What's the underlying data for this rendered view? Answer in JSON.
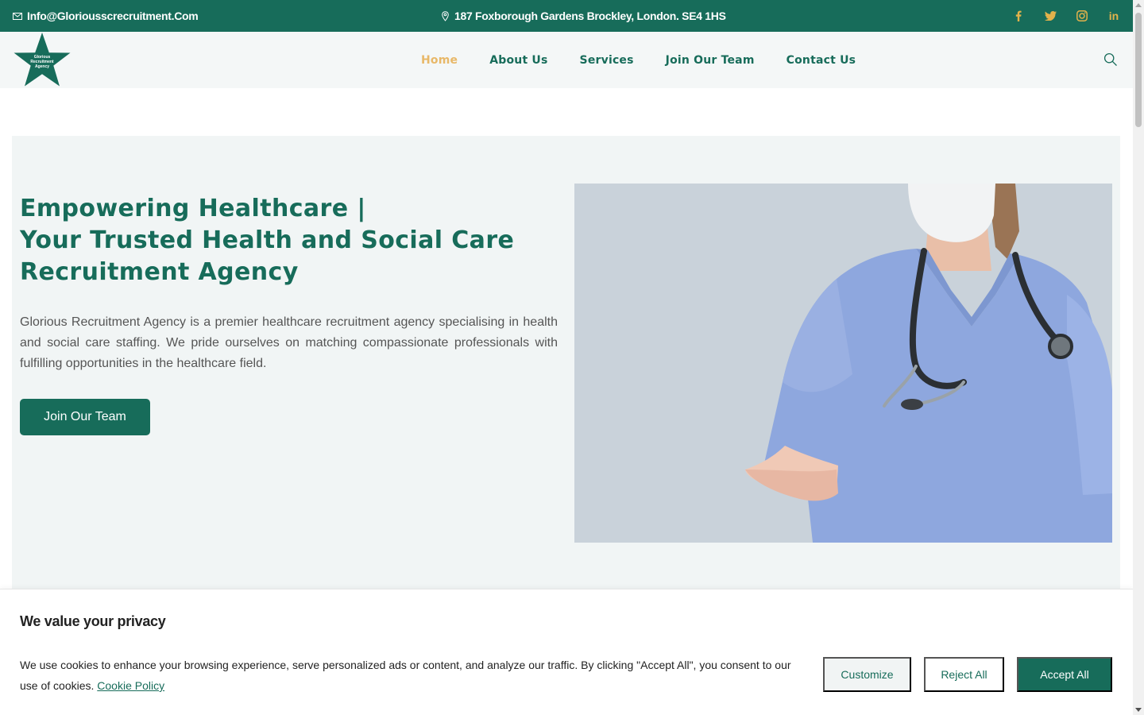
{
  "colors": {
    "brand": "#176c5a",
    "accent": "#e8b868",
    "hero_bg": "#f1f5f5",
    "header_bg": "#f4f7f7"
  },
  "topbar": {
    "email": "Info@Gloriousscrecruitment.Com",
    "address": "187 Foxborough Gardens Brockley, London. SE4 1HS",
    "socials": [
      {
        "name": "facebook-icon"
      },
      {
        "name": "twitter-icon"
      },
      {
        "name": "instagram-icon"
      },
      {
        "name": "linkedin-icon",
        "text": "in"
      }
    ]
  },
  "logo": {
    "text": "Glorious Recruitment Agency"
  },
  "nav": {
    "items": [
      {
        "label": "Home",
        "active": true
      },
      {
        "label": "About Us"
      },
      {
        "label": "Services"
      },
      {
        "label": "Join Our Team"
      },
      {
        "label": "Contact Us"
      }
    ]
  },
  "hero": {
    "title_line1": "Empowering Healthcare |",
    "title_line2": "Your Trusted Health and Social Care Recruitment Agency",
    "description": "Glorious Recruitment Agency is a premier healthcare recruitment agency specialising in health and social care staffing. We pride ourselves on matching compassionate professionals with fulfilling opportunities in the healthcare field.",
    "cta_label": "Join Our Team"
  },
  "cookie": {
    "title": "We value your privacy",
    "message": "We use cookies to enhance your browsing experience, serve personalized ads or content, and analyze our traffic. By clicking \"Accept All\", you consent to our use of cookies.",
    "policy_link": "Cookie Policy",
    "customize_label": "Customize",
    "reject_label": "Reject All",
    "accept_label": "Accept All"
  }
}
